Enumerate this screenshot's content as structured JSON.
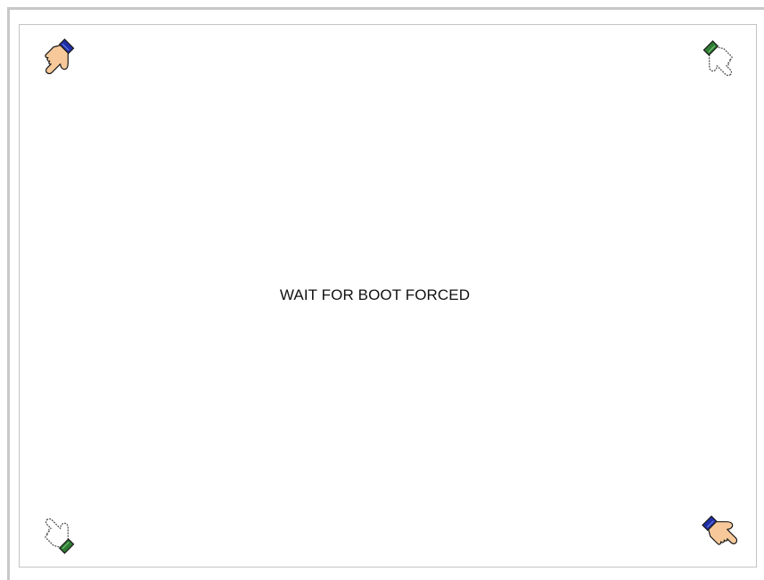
{
  "screen": {
    "message": "WAIT FOR BOOT FORCED"
  },
  "icons": {
    "top_left": "pointing-hand-icon",
    "top_right": "pointing-hand-icon",
    "bottom_left": "pointing-hand-icon",
    "bottom_right": "pointing-hand-icon"
  },
  "colors": {
    "skin": "#f7c99a",
    "cuff_blue": "#1f2fa8",
    "cuff_green": "#2e7d32",
    "outline": "#1a1a1a",
    "outline_dashed": "#444444"
  }
}
